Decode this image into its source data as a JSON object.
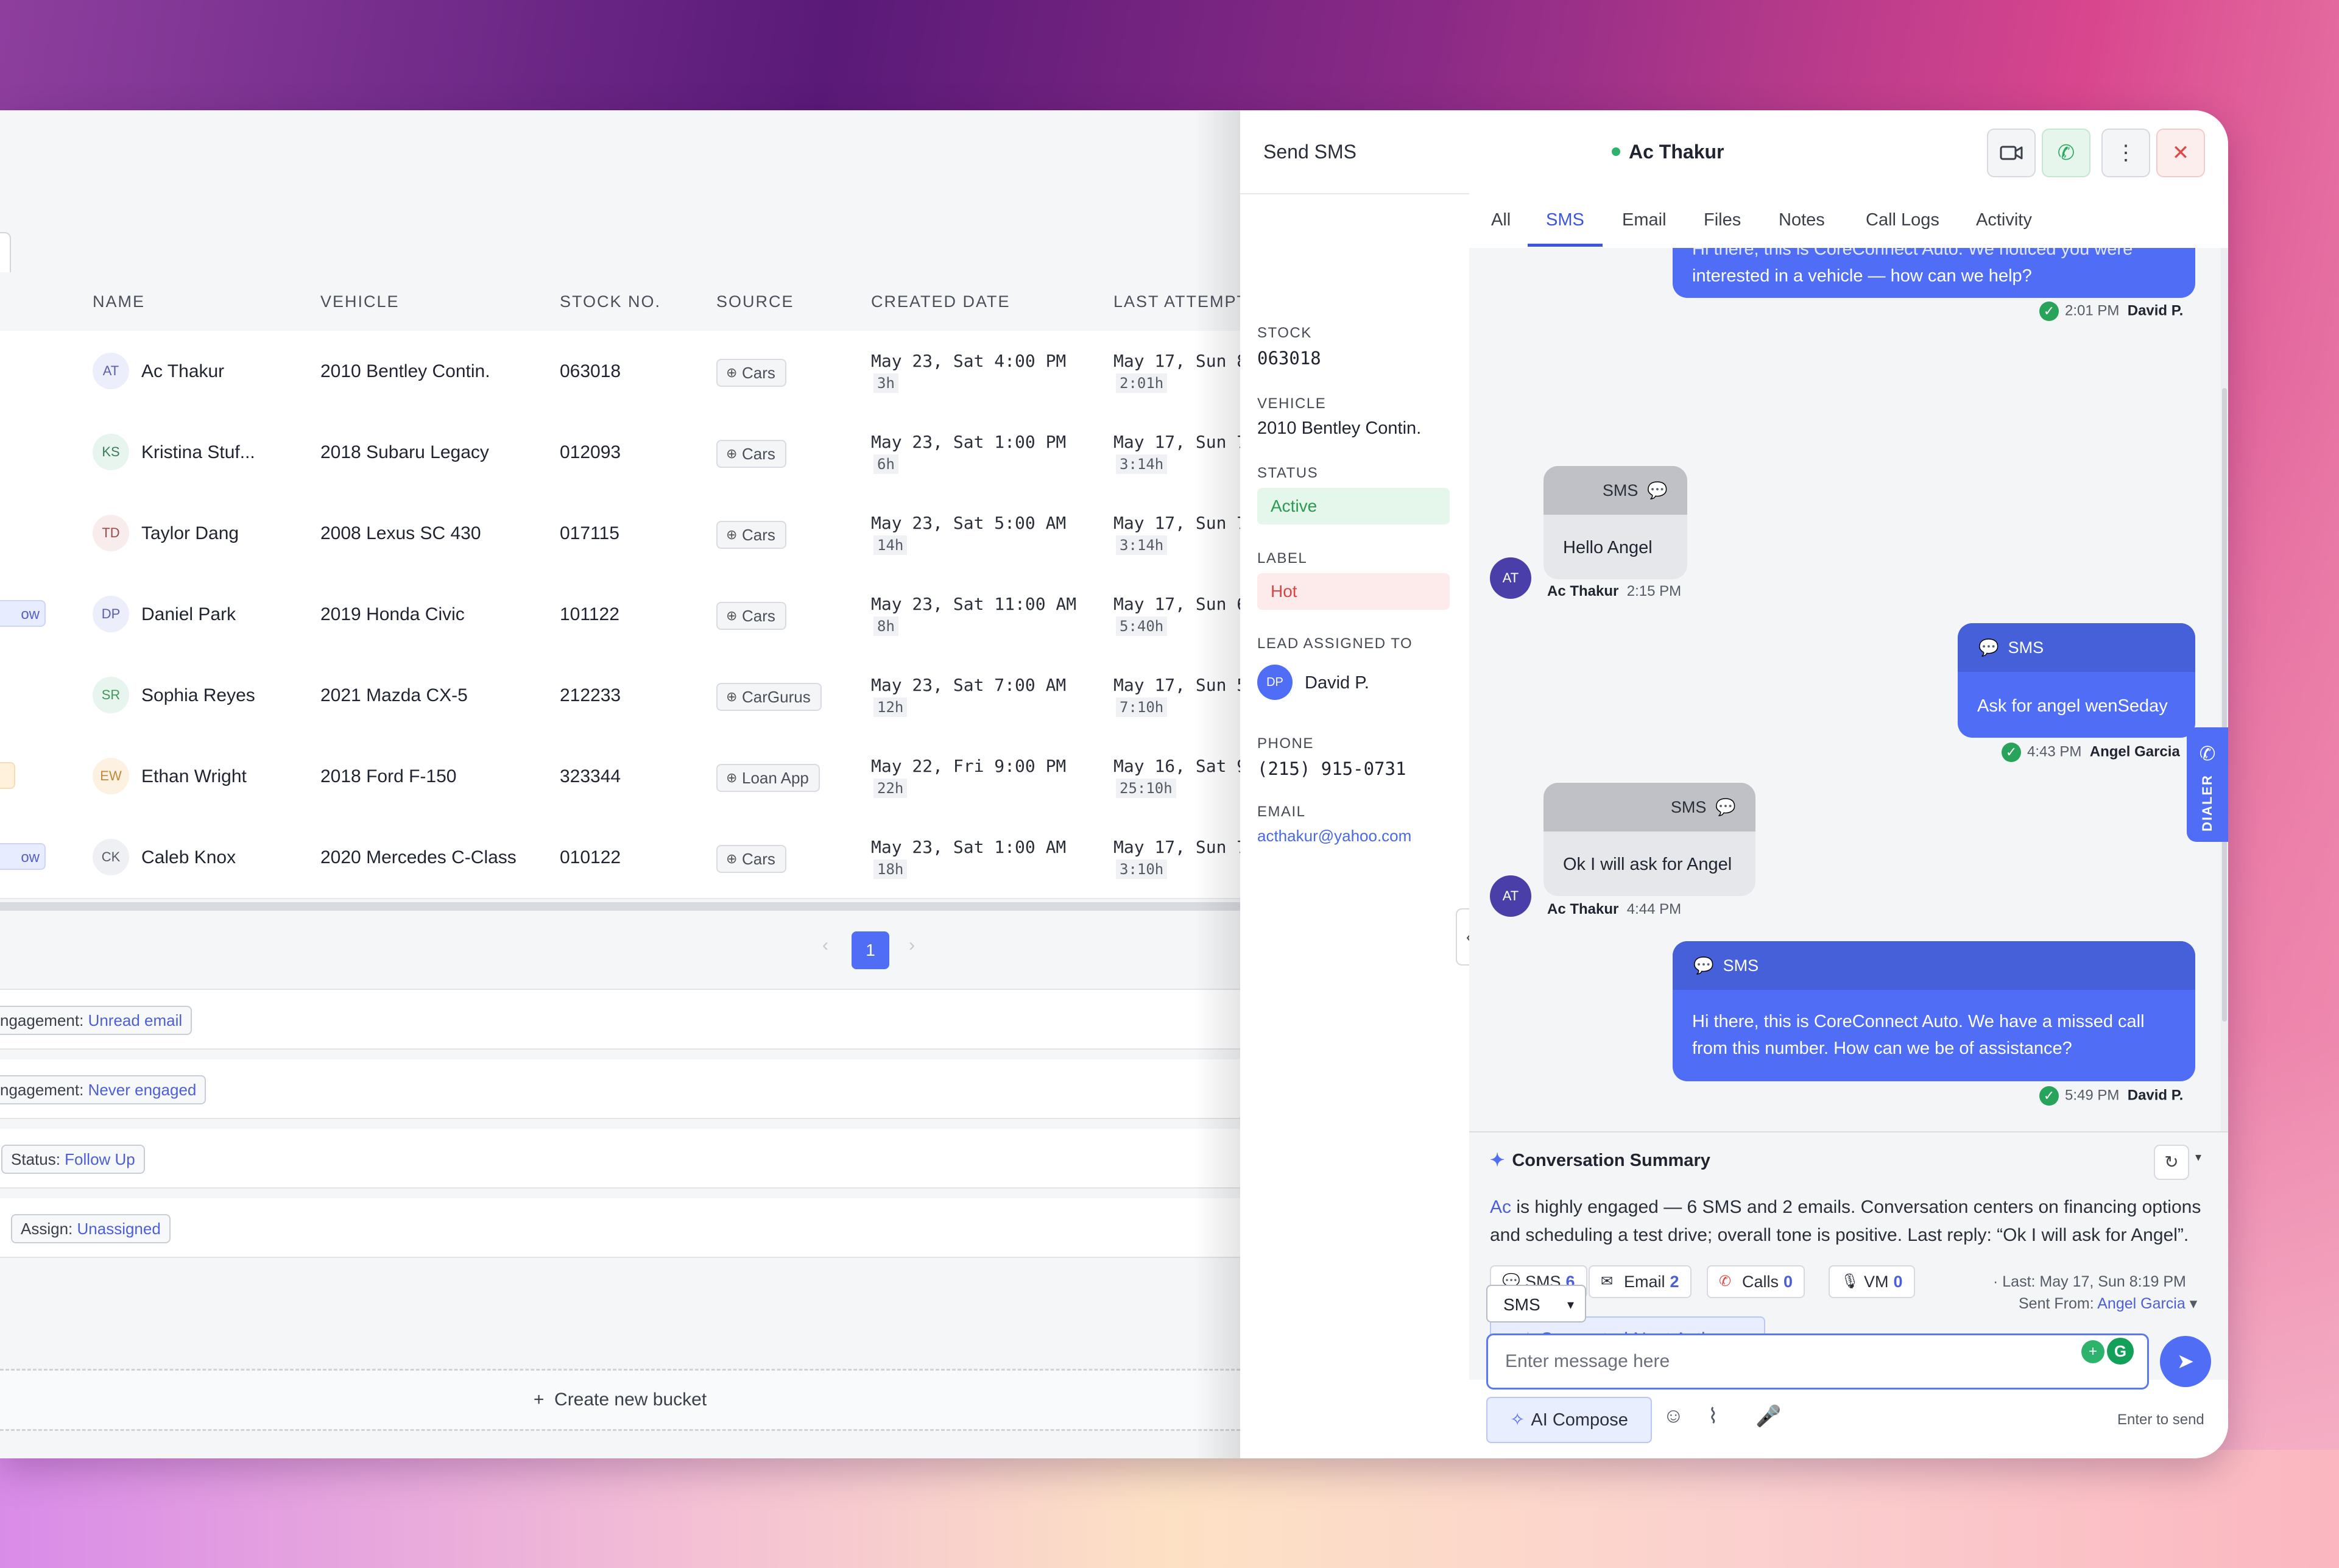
{
  "table": {
    "headers": {
      "name": "Name",
      "vehicle": "Vehicle",
      "stock": "Stock No.",
      "source": "Source",
      "created": "Created Date",
      "last": "Last Attempt"
    },
    "rows": [
      {
        "initials": "AT",
        "name": "Ac Thakur",
        "vehicle": "2010 Bentley Contin.",
        "stock": "063018",
        "source": "Cars",
        "created": "May 23, Sat 4:00 PM",
        "created_age": "3h",
        "last": "May 17, Sun 8",
        "last_age": "2:01h",
        "left_tag": ""
      },
      {
        "initials": "KS",
        "name": "Kristina Stuf...",
        "vehicle": "2018 Subaru Legacy",
        "stock": "012093",
        "source": "Cars",
        "created": "May 23, Sat 1:00 PM",
        "created_age": "6h",
        "last": "May 17, Sun 7",
        "last_age": "3:14h",
        "left_tag": ""
      },
      {
        "initials": "TD",
        "name": "Taylor Dang",
        "vehicle": "2008 Lexus SC 430",
        "stock": "017115",
        "source": "Cars",
        "created": "May 23, Sat 5:00 AM",
        "created_age": "14h",
        "last": "May 17, Sun 7",
        "last_age": "3:14h",
        "left_tag": ""
      },
      {
        "initials": "DP",
        "name": "Daniel Park",
        "vehicle": "2019 Honda Civic",
        "stock": "101122",
        "source": "Cars",
        "created": "May 23, Sat 11:00 AM",
        "created_age": "8h",
        "last": "May 17, Sun 6",
        "last_age": "5:40h",
        "left_tag": "ow"
      },
      {
        "initials": "SR",
        "name": "Sophia Reyes",
        "vehicle": "2021 Mazda CX-5",
        "stock": "212233",
        "source": "CarGurus",
        "created": "May 23, Sat 7:00 AM",
        "created_age": "12h",
        "last": "May 17, Sun 5",
        "last_age": "7:10h",
        "left_tag": ""
      },
      {
        "initials": "EW",
        "name": "Ethan Wright",
        "vehicle": "2018 Ford F-150",
        "stock": "323344",
        "source": "Loan App",
        "created": "May 22, Fri 9:00 PM",
        "created_age": "22h",
        "last": "May 16, Sat 9",
        "last_age": "25:10h",
        "left_tag": ""
      },
      {
        "initials": "CK",
        "name": "Caleb Knox",
        "vehicle": "2020 Mercedes C-Class",
        "stock": "010122",
        "source": "Cars",
        "created": "May 23, Sat 1:00 AM",
        "created_age": "18h",
        "last": "May 17, Sun 7",
        "last_age": "3:10h",
        "left_tag": "ow"
      }
    ]
  },
  "pager": {
    "prev": "‹",
    "page": "1",
    "next": "›"
  },
  "buckets": [
    {
      "key": "ngagement:",
      "value": "Unread email"
    },
    {
      "key": "ngagement:",
      "value": "Never engaged"
    },
    {
      "key": "Status:",
      "value": "Follow Up"
    },
    {
      "key": "Assign:",
      "value": "Unassigned"
    }
  ],
  "create_bucket": "Create new bucket",
  "panel": {
    "title": "Send SMS",
    "contact": "Ac Thakur",
    "info": {
      "stock_label": "Stock",
      "stock": "063018",
      "vehicle_label": "Vehicle",
      "vehicle": "2010 Bentley Contin.",
      "status_label": "Status",
      "status": "Active",
      "label_label": "Label",
      "label": "Hot",
      "assigned_label": "Lead Assigned To",
      "assigned_initials": "DP",
      "assigned": "David P.",
      "phone_label": "Phone",
      "phone": "(215) 915-0731",
      "email_label": "Email",
      "email": "acthakur@yahoo.com"
    },
    "tabs": [
      "All",
      "SMS",
      "Email",
      "Files",
      "Notes",
      "Call Logs",
      "Activity"
    ],
    "active_tab": "SMS"
  },
  "messages": [
    {
      "dir": "out",
      "line1": "Hi there, this is CoreConnect Auto. We noticed you were",
      "line2": "interested in a vehicle — how can we help?",
      "time": "2:01 PM",
      "author": "David P."
    },
    {
      "dir": "in",
      "type": "SMS",
      "text": "Hello Angel",
      "author": "Ac Thakur",
      "time": "2:15 PM",
      "initials": "AT"
    },
    {
      "dir": "out",
      "type": "SMS",
      "text": "Ask for angel wenSeday",
      "time": "4:43 PM",
      "author": "Angel Garcia"
    },
    {
      "dir": "in",
      "type": "SMS",
      "text": "Ok I will ask for Angel",
      "author": "Ac Thakur",
      "time": "4:44 PM",
      "initials": "AT"
    },
    {
      "dir": "out",
      "type": "SMS",
      "line1": "Hi there, this is CoreConnect Auto. We have a missed call",
      "line2": "from this number. How can we be of assistance?",
      "time": "5:49 PM",
      "author": "David P."
    }
  ],
  "summary": {
    "title": "Conversation Summary",
    "name": "Ac",
    "line1": " is highly engaged — 6 SMS and 2 emails. Conversation centers on financing options",
    "line2": "and scheduling a test drive; overall tone is positive. Last reply: “Ok I will ask for Angel”.",
    "stats": [
      {
        "label": "SMS",
        "count": "6",
        "icon": "chat-icon"
      },
      {
        "label": "Email",
        "count": "2",
        "icon": "mail-icon"
      },
      {
        "label": "Calls",
        "count": "0",
        "icon": "phone-icon"
      },
      {
        "label": "VM",
        "count": "0",
        "icon": "mic-icon"
      }
    ],
    "last": "· Last: May 17, Sun 8:19 PM",
    "suggest": "Suggested Next Actions"
  },
  "composer": {
    "channel": "SMS",
    "sent_from_label": "Sent From:",
    "sent_from": "Angel Garcia",
    "placeholder": "Enter message here",
    "ai_compose": "AI Compose",
    "enter_hint": "Enter to send"
  },
  "dialer": "DIALER",
  "colors": {
    "accent": "#4f6df5",
    "success": "#2db36b",
    "danger": "#e04848"
  }
}
